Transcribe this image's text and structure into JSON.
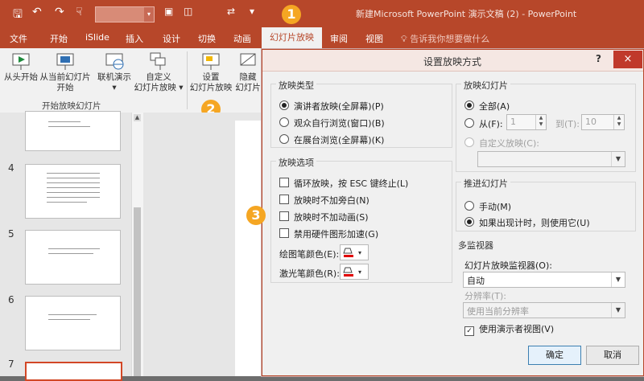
{
  "titlebar": {
    "doc_title": "新建Microsoft PowerPoint 演示文稿 (2)  -  PowerPoint",
    "save_glyph": "🖫",
    "undo_glyph": "↶",
    "redo_glyph": "↷",
    "dropdown_glyph": "▾"
  },
  "tabs": [
    {
      "label": "文件"
    },
    {
      "label": "开始"
    },
    {
      "label": "iSlide"
    },
    {
      "label": "插入"
    },
    {
      "label": "设计"
    },
    {
      "label": "切换"
    },
    {
      "label": "动画"
    },
    {
      "label": "幻灯片放映"
    },
    {
      "label": "审阅"
    },
    {
      "label": "视图"
    },
    {
      "label": "告诉我你想要做什么"
    }
  ],
  "ribbon": {
    "buttons": [
      {
        "label": "从头开始"
      },
      {
        "label": "从当前幻灯片\n开始"
      },
      {
        "label": "联机演示\n▾"
      },
      {
        "label": "自定义\n幻灯片放映 ▾"
      },
      {
        "label": "设置\n幻灯片放映"
      },
      {
        "label": "隐藏\n幻灯片"
      }
    ],
    "group_label": "开始放映幻灯片"
  },
  "thumbnails": [
    {
      "num": ""
    },
    {
      "num": "4"
    },
    {
      "num": "5"
    },
    {
      "num": "6"
    },
    {
      "num": "7"
    }
  ],
  "badges": {
    "one": "1",
    "two": "2",
    "three": "3"
  },
  "dialog": {
    "title": "设置放映方式",
    "help": "?",
    "close": "×",
    "show_type": {
      "legend": "放映类型",
      "options": [
        {
          "label": "演讲者放映(全屏幕)(P)",
          "selected": true
        },
        {
          "label": "观众自行浏览(窗口)(B)",
          "selected": false
        },
        {
          "label": "在展台浏览(全屏幕)(K)",
          "selected": false
        }
      ]
    },
    "show_options": {
      "legend": "放映选项",
      "checks": [
        {
          "label": "循环放映，按 ESC 键终止(L)",
          "checked": false
        },
        {
          "label": "放映时不加旁白(N)",
          "checked": false
        },
        {
          "label": "放映时不加动画(S)",
          "checked": false
        },
        {
          "label": "禁用硬件图形加速(G)",
          "checked": false
        }
      ],
      "pen_color_label": "绘图笔颜色(E):",
      "laser_color_label": "激光笔颜色(R):",
      "pen_color": "#e00000",
      "laser_color": "#e00000"
    },
    "show_slides": {
      "legend": "放映幻灯片",
      "all": "全部(A)",
      "from": "从(F):",
      "from_value": "1",
      "to": "到(T):",
      "to_value": "10",
      "custom": "自定义放映(C):"
    },
    "advance": {
      "legend": "推进幻灯片",
      "manual": "手动(M)",
      "timings": "如果出现计时，则使用它(U)"
    },
    "monitors": {
      "legend": "多监视器",
      "monitor_label": "幻灯片放映监视器(O):",
      "monitor_value": "自动",
      "resolution_label": "分辨率(T):",
      "resolution_value": "使用当前分辨率",
      "presenter_view": "使用演示者视图(V)"
    },
    "ok": "确定",
    "cancel": "取消"
  }
}
